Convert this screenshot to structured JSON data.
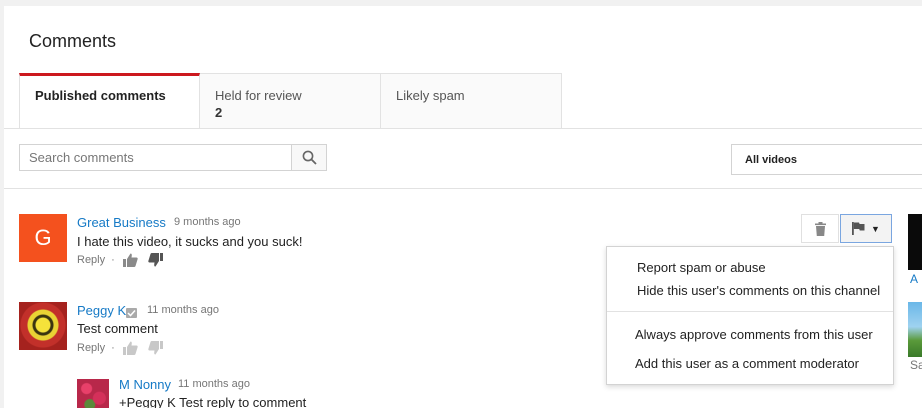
{
  "page": {
    "title": "Comments"
  },
  "tabs": [
    {
      "label": "Published comments",
      "count": ""
    },
    {
      "label": "Held for review",
      "count": "2"
    },
    {
      "label": "Likely spam",
      "count": ""
    }
  ],
  "search": {
    "placeholder": "Search comments",
    "value": ""
  },
  "filter": {
    "selected": "All videos"
  },
  "comments": [
    {
      "avatar_letter": "G",
      "author": "Great Business",
      "time": "9 months ago",
      "text": "I hate this video, it sucks and you suck!",
      "reply_label": "Reply",
      "separator": "·"
    },
    {
      "author": "Peggy K",
      "time": "11 months ago",
      "text": "Test comment",
      "reply_label": "Reply",
      "separator": "·"
    },
    {
      "author": "M Nonny",
      "time": "11 months ago",
      "text": "+Peggy K Test reply to comment"
    }
  ],
  "context_menu": {
    "items": [
      "Report spam or abuse",
      "Hide this user's comments on this channel",
      "Always approve comments from this user",
      "Add this user as a comment moderator"
    ]
  },
  "side_thumbs": {
    "first_label": "A",
    "second_label": "Sa"
  },
  "colors": {
    "accent_red": "#cc181e",
    "link_blue": "#167ac6",
    "avatar_orange": "#f4511e"
  },
  "icons": [
    "search-icon",
    "thumbs-up-icon",
    "thumbs-down-icon",
    "trash-icon",
    "flag-icon",
    "chevron-down-icon",
    "verified-icon"
  ]
}
